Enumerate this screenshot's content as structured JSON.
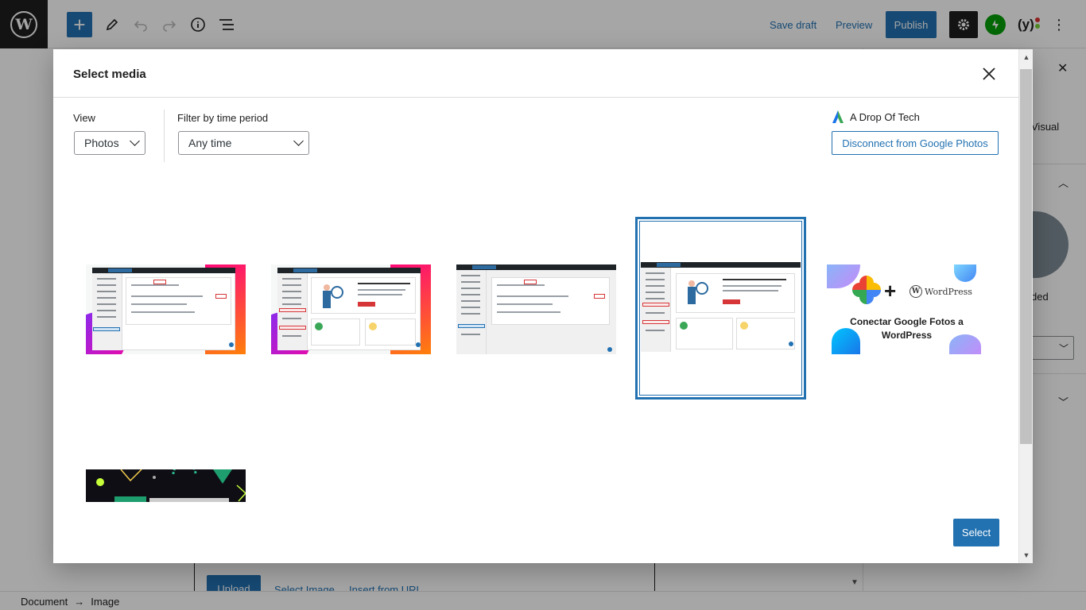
{
  "toolbar": {
    "save_draft": "Save draft",
    "preview": "Preview",
    "publish": "Publish",
    "inserter_glyph": "+",
    "icons": [
      "wordpress-icon",
      "plus-icon",
      "pencil-icon",
      "undo-icon",
      "redo-icon",
      "info-icon",
      "list-view-icon",
      "gear-icon",
      "jetpack-icon",
      "yoast-icon",
      "more-vertical-icon"
    ]
  },
  "sidebar": {
    "visual_label": "Visual",
    "ded_label": "ded"
  },
  "placeholder": {
    "upload": "Upload",
    "select_image": "Select Image",
    "insert_from_url": "Insert from URL"
  },
  "breadcrumb": {
    "document": "Document",
    "separator": "→",
    "image": "Image"
  },
  "modal": {
    "title": "Select media",
    "close_glyph": "×",
    "view_label": "View",
    "view_value": "Photos",
    "filter_label": "Filter by time period",
    "filter_value": "Any time",
    "account_name": "A Drop Of Tech",
    "disconnect_label": "Disconnect from Google Photos",
    "select_label": "Select",
    "selected_index": 3,
    "items": [
      {
        "kind": "screenshot",
        "variant": "settings"
      },
      {
        "kind": "screenshot",
        "variant": "marketing"
      },
      {
        "kind": "screenshot",
        "variant": "settings-plain"
      },
      {
        "kind": "screenshot",
        "variant": "marketing-plain",
        "selected": true
      },
      {
        "kind": "promo",
        "text_line1": "Conectar Google Fotos a",
        "text_line2": "WordPress",
        "wordpress_label": "WordPress"
      },
      {
        "kind": "dark-banner"
      }
    ]
  },
  "colors": {
    "accent": "#2271b1",
    "toolbar_dark": "#1e1e1e",
    "jetpack": "#069e08",
    "overlay": "rgba(0,0,0,0.35)"
  }
}
